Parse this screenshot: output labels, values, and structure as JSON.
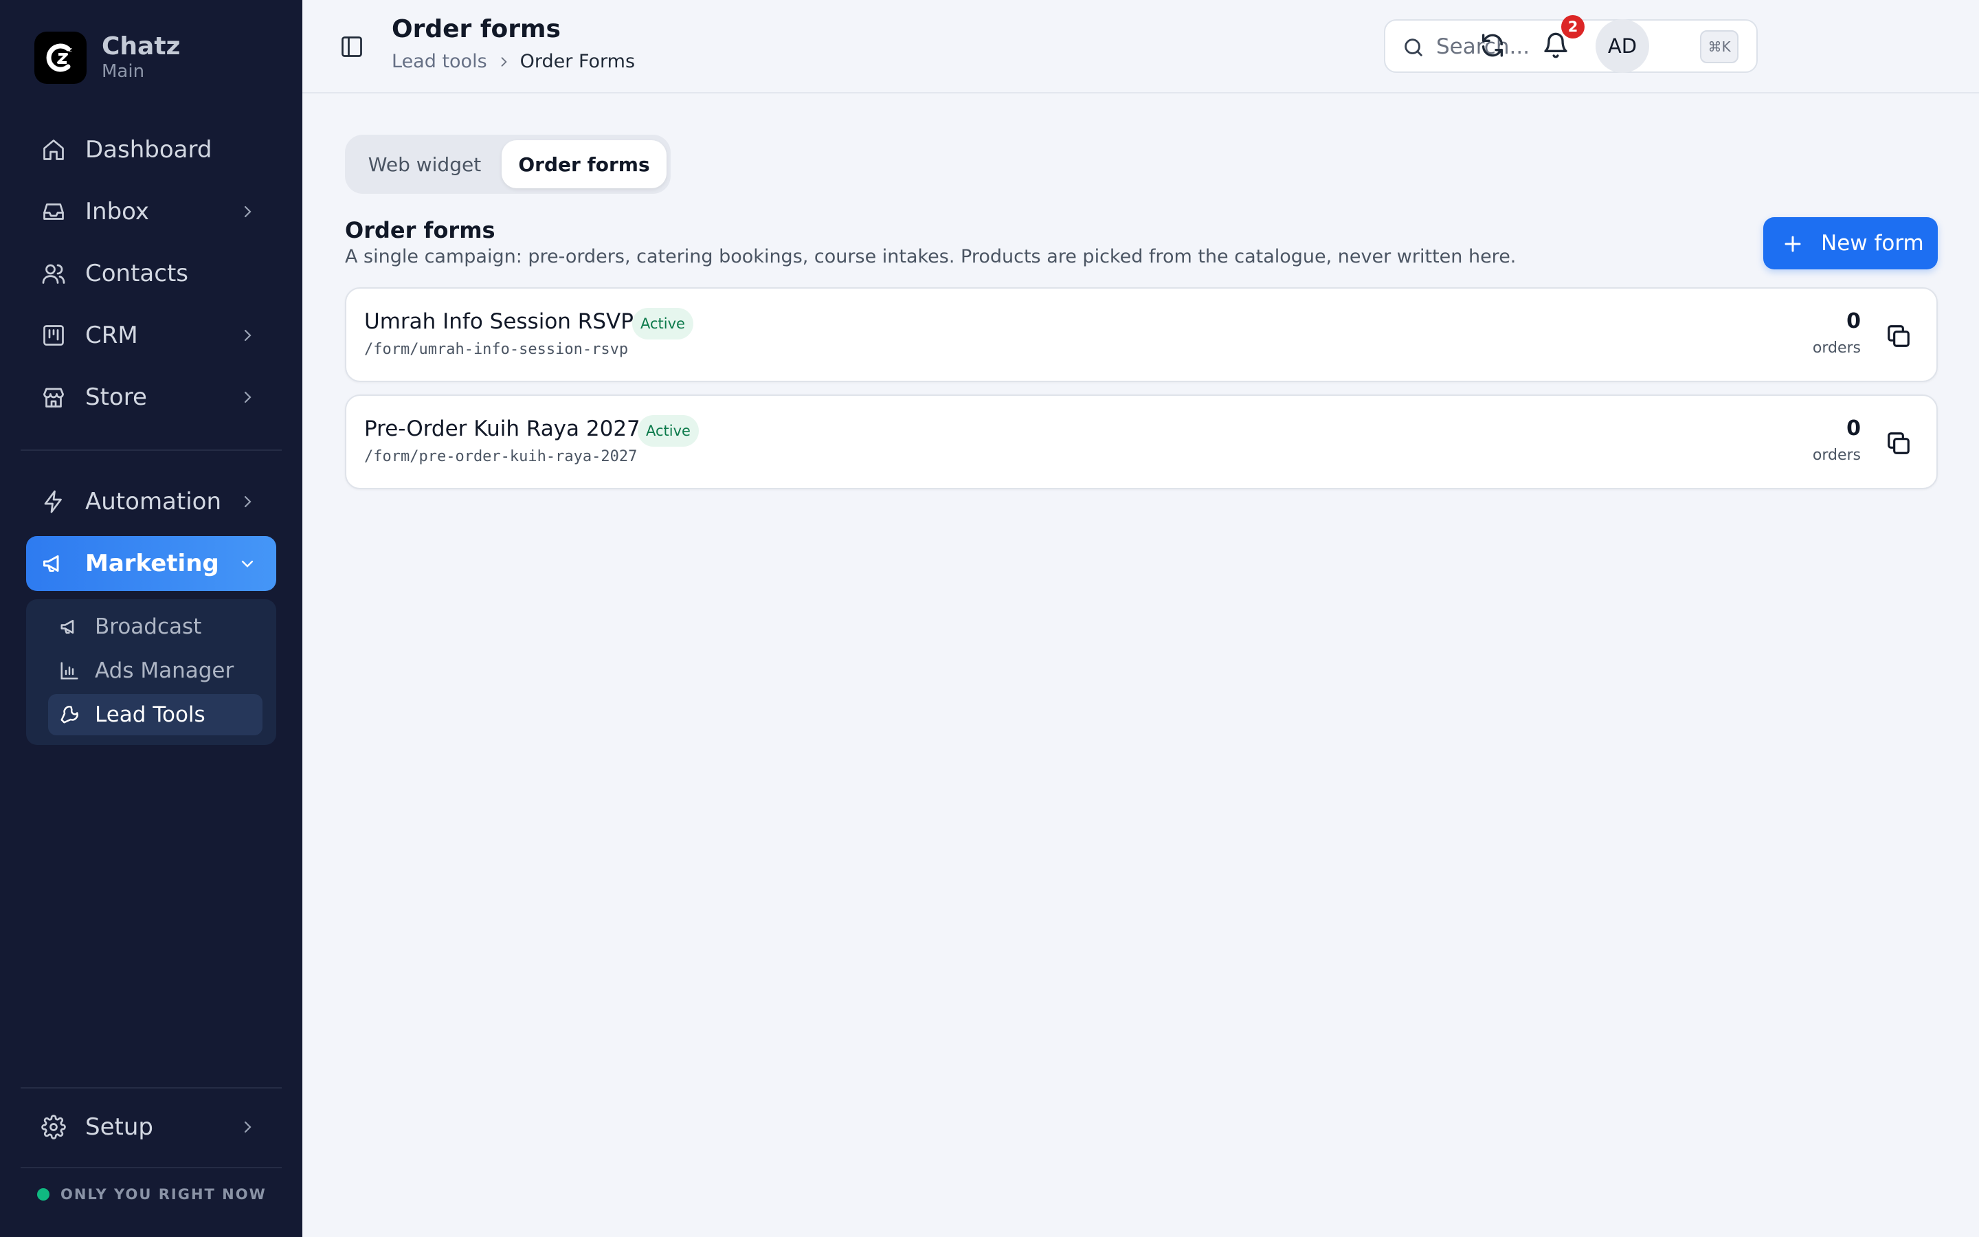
{
  "brand": {
    "name": "Chatz",
    "workspace": "Main"
  },
  "sidebar": {
    "items": [
      {
        "label": "Dashboard",
        "icon": "home-icon"
      },
      {
        "label": "Inbox",
        "icon": "inbox-icon"
      },
      {
        "label": "Contacts",
        "icon": "users-icon"
      },
      {
        "label": "CRM",
        "icon": "kanban-icon"
      },
      {
        "label": "Store",
        "icon": "store-icon"
      },
      {
        "label": "Automation",
        "icon": "bolt-icon"
      },
      {
        "label": "Marketing",
        "icon": "megaphone-icon",
        "active": true
      }
    ],
    "marketing_sub": [
      {
        "label": "Broadcast",
        "icon": "megaphone-icon"
      },
      {
        "label": "Ads Manager",
        "icon": "bar-chart-icon"
      },
      {
        "label": "Lead Tools",
        "icon": "wrench-icon",
        "active": true
      }
    ],
    "setup": {
      "label": "Setup",
      "icon": "gear-icon"
    },
    "status": "ONLY YOU RIGHT NOW"
  },
  "header": {
    "title": "Order forms",
    "breadcrumb": [
      "Lead tools",
      "Order Forms"
    ],
    "search_placeholder": "Search...",
    "shortcut": "⌘K",
    "notification_count": "2",
    "avatar_initials": "AD"
  },
  "tabs": [
    {
      "label": "Web widget",
      "active": false
    },
    {
      "label": "Order forms",
      "active": true
    }
  ],
  "section": {
    "title": "Order forms",
    "description": "A single campaign: pre-orders, catering bookings, course intakes. Products are picked from the catalogue, never written here.",
    "new_button": "New form"
  },
  "forms": [
    {
      "name": "Umrah Info Session RSVP",
      "status": "Active",
      "path": "/form/umrah-info-session-rsvp",
      "orders": "0",
      "orders_label": "orders"
    },
    {
      "name": "Pre-Order Kuih Raya 2027",
      "status": "Active",
      "path": "/form/pre-order-kuih-raya-2027",
      "orders": "0",
      "orders_label": "orders"
    }
  ],
  "colors": {
    "sidebar_bg": "#141a33",
    "accent": "#1d6ff2",
    "active_badge_bg": "#e6f6ee",
    "active_badge_text": "#0c7a4b",
    "notification": "#dc2626"
  }
}
